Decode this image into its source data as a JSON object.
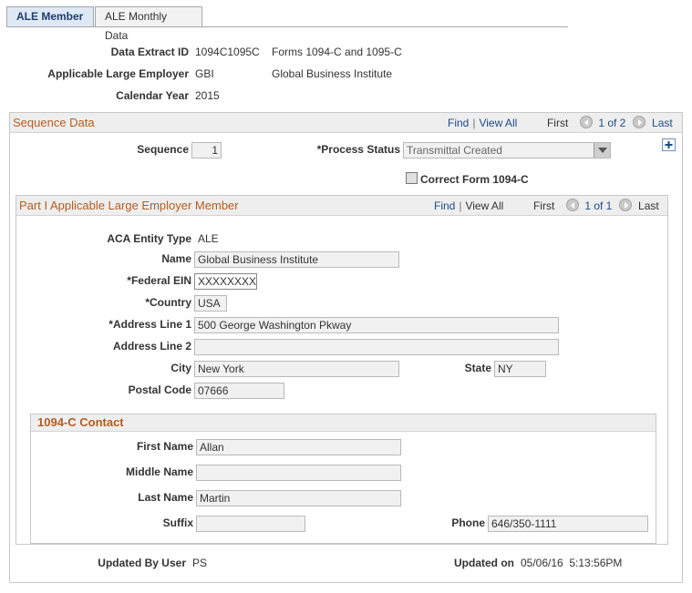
{
  "tabs": [
    {
      "label": "ALE Member",
      "active": true
    },
    {
      "label": "ALE Monthly Data",
      "active": false
    }
  ],
  "header": {
    "data_extract_id_label": "Data Extract ID",
    "data_extract_id": "1094C1095C",
    "data_extract_desc": "Forms 1094-C and 1095-C",
    "ale_label": "Applicable Large Employer",
    "ale_code": "GBI",
    "ale_name": "Global Business Institute",
    "calendar_year_label": "Calendar Year",
    "calendar_year": "2015"
  },
  "sequence_data": {
    "title": "Sequence Data",
    "nav": {
      "find": "Find",
      "view_all": "View All",
      "first": "First",
      "count": "1 of 2",
      "last": "Last"
    },
    "sequence_label": "Sequence",
    "sequence_value": "1",
    "process_status_label": "*Process Status",
    "process_status_value": "Transmittal Created",
    "correct_form_label": "Correct Form 1094-C",
    "correct_form_checked": false
  },
  "part1": {
    "title": "Part I Applicable Large Employer Member",
    "nav": {
      "find": "Find",
      "view_all": "View All",
      "first": "First",
      "count": "1 of 1",
      "last": "Last"
    },
    "aca_entity_type_label": "ACA Entity Type",
    "aca_entity_type": "ALE",
    "name_label": "Name",
    "name": "Global Business Institute",
    "federal_ein_label": "*Federal EIN",
    "federal_ein": "XXXXXXXXX",
    "country_label": "*Country",
    "country": "USA",
    "address1_label": "*Address Line 1",
    "address1": "500 George Washington Pkway",
    "address2_label": "Address Line 2",
    "address2": "",
    "city_label": "City",
    "city": "New York",
    "state_label": "State",
    "state": "NY",
    "postal_code_label": "Postal Code",
    "postal_code": "07666"
  },
  "contact": {
    "title": "1094-C Contact",
    "first_name_label": "First Name",
    "first_name": "Allan",
    "middle_name_label": "Middle Name",
    "middle_name": "",
    "last_name_label": "Last Name",
    "last_name": "Martin",
    "suffix_label": "Suffix",
    "suffix": "",
    "phone_label": "Phone",
    "phone": "646/350-1111"
  },
  "footer": {
    "updated_by_label": "Updated By User",
    "updated_by": "PS",
    "updated_on_label": "Updated on",
    "updated_on": "05/06/16  5:13:56PM"
  },
  "colors": {
    "accent_orange": "#b55d21",
    "link_blue": "#1c4b8a",
    "tab_active_bg": "#dfe9f5"
  }
}
